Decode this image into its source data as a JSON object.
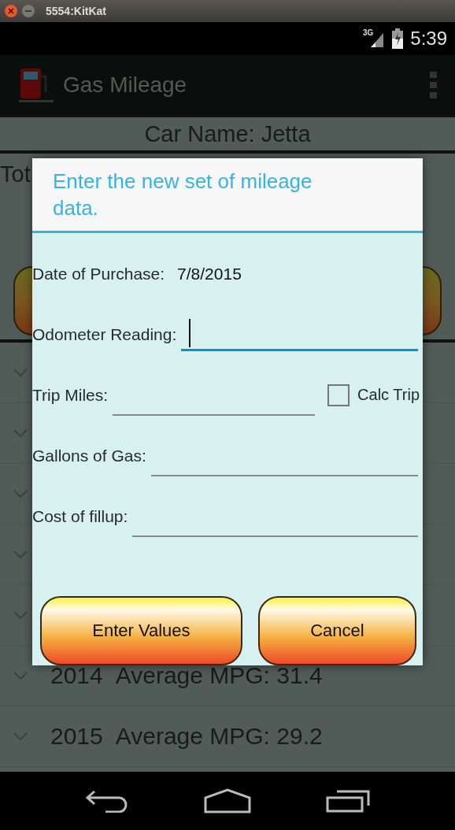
{
  "window": {
    "title": "5554:KitKat"
  },
  "status_bar": {
    "network": "3G",
    "time": "5:39"
  },
  "action_bar": {
    "title": "Gas Mileage"
  },
  "car_header": {
    "text": "Car Name: Jetta"
  },
  "summary": {
    "text": "Tot"
  },
  "list": {
    "rows": [
      {
        "kind": "covered"
      },
      {
        "kind": "covered"
      },
      {
        "kind": "covered"
      },
      {
        "kind": "covered"
      },
      {
        "kind": "covered"
      },
      {
        "kind": "entry",
        "year": "2014",
        "label": "Average MPG: 31.4"
      },
      {
        "kind": "entry",
        "year": "2015",
        "label": "Average MPG: 29.2"
      }
    ]
  },
  "dialog": {
    "title": "Enter the new set of mileage data.",
    "fields": [
      {
        "kind": "static",
        "label": "Date of Purchase:",
        "value": "7/8/2015"
      },
      {
        "kind": "input",
        "label": "Odometer Reading:",
        "focused": true
      },
      {
        "kind": "input",
        "label": "Trip Miles:",
        "focused": false,
        "checkbox": {
          "label": "Calc Trip",
          "checked": false
        }
      },
      {
        "kind": "input",
        "label": "Gallons of Gas:",
        "focused": false
      },
      {
        "kind": "input",
        "label": "Cost of fillup:",
        "focused": false
      }
    ],
    "buttons": [
      "Enter Values",
      "Cancel"
    ]
  }
}
